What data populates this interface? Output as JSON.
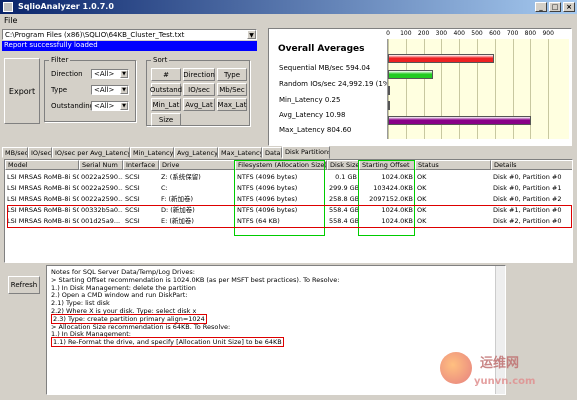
{
  "window": {
    "title": "SqlioAnalyzer 1.0.7.0"
  },
  "menu": {
    "file": "File"
  },
  "toolbar": {
    "path": "C:\\Program Files (x86)\\SQLIO\\64KB_Cluster_Test.txt",
    "status": "Report successfully loaded",
    "export_label": "Export",
    "refresh_label": "Refresh"
  },
  "filter": {
    "legend": "Filter",
    "rows": [
      {
        "label": "Direction",
        "value": "<All>"
      },
      {
        "label": "Type",
        "value": "<All>"
      },
      {
        "label": "Outstanding",
        "value": "<All>"
      }
    ]
  },
  "sort": {
    "legend": "Sort",
    "buttons": [
      "#",
      "Direction",
      "Type",
      "Outstand",
      "IO/sec",
      "Mb/Sec",
      "Min_Lat",
      "Avg_Lat",
      "Max_Lat",
      "Size"
    ]
  },
  "averages": {
    "heading": "Overall Averages",
    "metrics": [
      "Sequential MB/sec 594.04",
      "Random IOs/sec 24,992.19 (1% gr",
      "Min_Latency 0.25",
      "Avg_Latency 10.98",
      "Max_Latency 804.60"
    ]
  },
  "chart_data": {
    "type": "bar",
    "orientation": "horizontal",
    "categories": [
      "Sequential MB/sec",
      "Random IOs/sec",
      "Min_Latency",
      "Avg_Latency",
      "Max_Latency"
    ],
    "values": [
      594.04,
      0,
      0.25,
      10.98,
      804.6
    ],
    "colors": [
      "#ee2222",
      "#22cc22",
      "#dddddd",
      "#dddddd",
      "#880088"
    ],
    "xlim": [
      0,
      1000
    ],
    "ticks": [
      "0",
      "100",
      "200",
      "300",
      "400",
      "500",
      "600",
      "700",
      "800",
      "900"
    ],
    "grid": true
  },
  "tabs": [
    "MB/sec",
    "IO/sec",
    "IO/sec per Avg_Latency",
    "Min_Latency",
    "Avg_Latency",
    "Max_Latency",
    "Data",
    "Disk Partitions"
  ],
  "table": {
    "columns": [
      "Model",
      "Serial Num",
      "Interface",
      "Drive",
      "Filesystem (Allocation Size)",
      "Disk Size",
      "Starting Offset",
      "Status",
      "Details"
    ],
    "rows": [
      [
        "LSI MRSAS RoMB-8i SCSI Disk ...",
        "0022a2590...",
        "SCSI",
        "Z: (系统保留)",
        "NTFS (4096 bytes)",
        "0.1 GB",
        "1024.0KB",
        "OK",
        "Disk #0, Partition #0"
      ],
      [
        "LSI MRSAS RoMB-8i SCSI Disk ...",
        "0022a2590...",
        "SCSI",
        "C:",
        "NTFS (4096 bytes)",
        "299.9 GB",
        "103424.0KB",
        "OK",
        "Disk #0, Partition #1"
      ],
      [
        "LSI MRSAS RoMB-8i SCSI Disk ...",
        "0022a2590...",
        "SCSI",
        "F: (新加卷)",
        "NTFS (4096 bytes)",
        "258.8 GB",
        "2097152.0KB",
        "OK",
        "Disk #0, Partition #2"
      ],
      [
        "LSI MRSAS RoMB-8i SCSI Disk ...",
        "00332b5a0...",
        "SCSI",
        "D: (新加卷)",
        "NTFS (4096 bytes)",
        "558.4 GB",
        "1024.0KB",
        "OK",
        "Disk #1, Partition #0"
      ],
      [
        "LSI MRSAS RoMB-8i SCSI Disk ...",
        "001d25a9...",
        "SCSI",
        "E: (新加卷)",
        "NTFS (64 KB)",
        "558.4 GB",
        "1024.0KB",
        "OK",
        "Disk #2, Partition #0"
      ]
    ]
  },
  "notes": {
    "lines": [
      "Notes for SQL Server Data/Temp/Log Drives:",
      "> Starting Offset recommendation is 1024.0KB (as per MSFT best practices).  To Resolve:",
      "    1.) In Disk Management: delete the partition",
      "    2.) Open a CMD window and run DiskPart:",
      "        2.1) Type: list disk",
      "        2.2) Where X is your disk. Type: select disk x",
      "        2.3) Type: create partition primary align=1024",
      "> Allocation Size recommendation is 64KB.  To Resolve:",
      "    1.) In Disk Management:",
      "        1.1) Re-Format the drive, and specify [Allocation Unit Size] to be 64KB"
    ]
  },
  "watermark": {
    "line1": "运维网",
    "line2": "yunvn.com"
  }
}
